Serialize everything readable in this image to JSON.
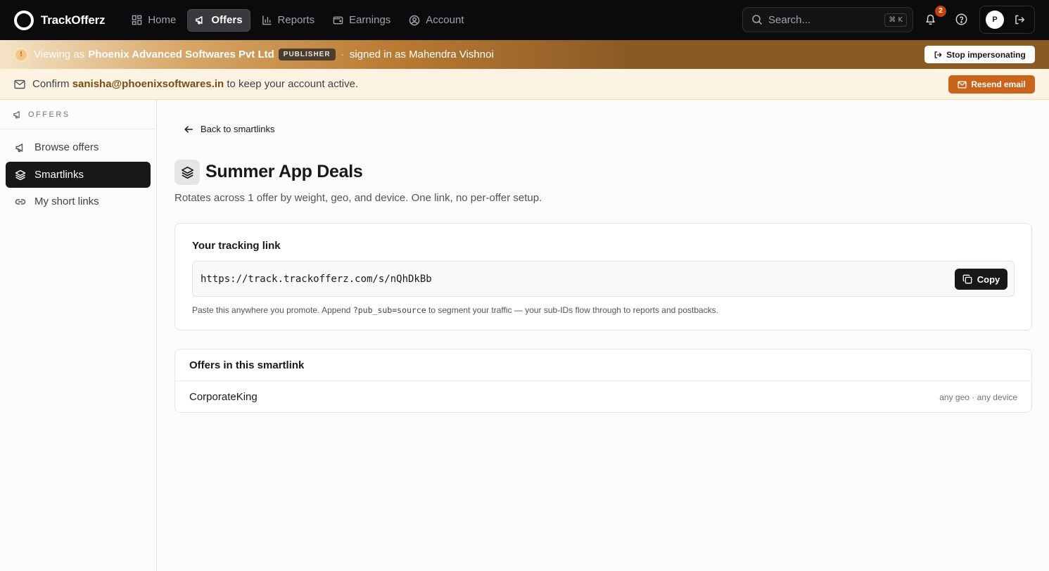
{
  "brand": {
    "name": "TrackOfferz"
  },
  "nav": {
    "items": [
      {
        "label": "Home",
        "icon": "grid-icon",
        "active": false
      },
      {
        "label": "Offers",
        "icon": "megaphone-icon",
        "active": true
      },
      {
        "label": "Reports",
        "icon": "bar-chart-icon",
        "active": false
      },
      {
        "label": "Earnings",
        "icon": "wallet-icon",
        "active": false
      },
      {
        "label": "Account",
        "icon": "user-circle-icon",
        "active": false
      }
    ],
    "search_placeholder": "Search...",
    "search_shortcut": "⌘ K",
    "notification_count": "2",
    "avatar_initial": "P"
  },
  "impersonation": {
    "icon_glyph": "!",
    "viewing_as_label": "Viewing as",
    "org_name": "Phoenix Advanced Softwares Pvt Ltd",
    "role_badge": "PUBLISHER",
    "separator": "·",
    "signed_in_text": "signed in as Mahendra Vishnoi",
    "stop_button": "Stop impersonating"
  },
  "confirm_email": {
    "prefix": "Confirm",
    "email": "sanisha@phoenixsoftwares.in",
    "suffix": "to keep your account active.",
    "resend_button": "Resend email"
  },
  "sidebar": {
    "section_label": "OFFERS",
    "items": [
      {
        "label": "Browse offers",
        "icon": "megaphone-icon",
        "active": false
      },
      {
        "label": "Smartlinks",
        "icon": "layers-icon",
        "active": true
      },
      {
        "label": "My short links",
        "icon": "link-icon",
        "active": false
      }
    ]
  },
  "main": {
    "back_link": "Back to smartlinks",
    "title": "Summer App Deals",
    "subtitle": "Rotates across 1 offer by weight, geo, and device. One link, no per-offer setup.",
    "tracking": {
      "heading": "Your tracking link",
      "url": "https://track.trackofferz.com/s/nQhDkBb",
      "copy_button": "Copy",
      "hint_prefix": "Paste this anywhere you promote. Append",
      "hint_code": "?pub_sub=source",
      "hint_suffix": "to segment your traffic — your sub-IDs flow through to reports and postbacks."
    },
    "offers_card": {
      "heading": "Offers in this smartlink",
      "offers": [
        {
          "name": "CorporateKing",
          "meta": "any geo · any device"
        }
      ]
    }
  },
  "colors": {
    "nav_bg": "#0b0b0d",
    "accent_orange": "#c9641a",
    "active_dark": "#18181b",
    "banner_cream": "#fdf3e3"
  }
}
